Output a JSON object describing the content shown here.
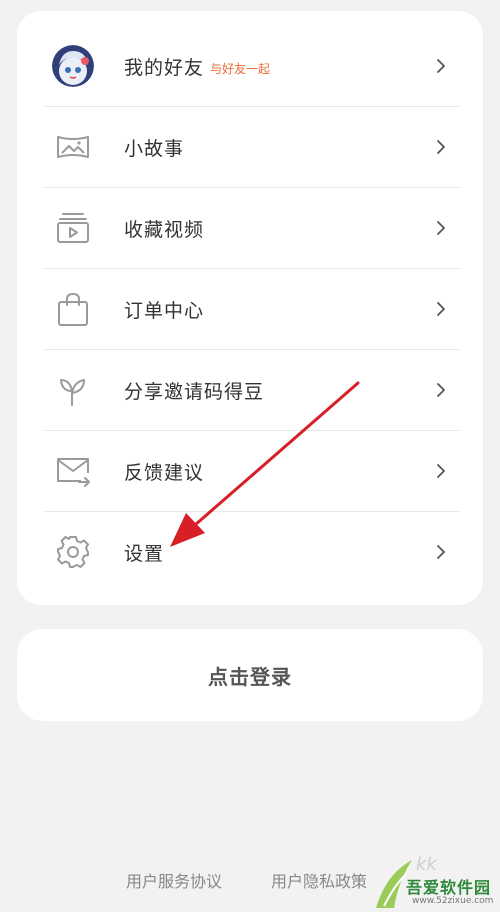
{
  "menu": {
    "items": [
      {
        "label": "我的好友",
        "sub": "与好友一起",
        "icon": "friend-avatar"
      },
      {
        "label": "小故事",
        "icon": "picture-icon"
      },
      {
        "label": "收藏视频",
        "icon": "video-collection-icon"
      },
      {
        "label": "订单中心",
        "icon": "shopping-bag-icon"
      },
      {
        "label": "分享邀请码得豆",
        "icon": "sprout-icon"
      },
      {
        "label": "反馈建议",
        "icon": "mail-feedback-icon"
      },
      {
        "label": "设置",
        "icon": "gear-icon"
      }
    ]
  },
  "login": {
    "label": "点击登录"
  },
  "footer": {
    "terms": "用户服务协议",
    "privacy": "用户隐私政策"
  },
  "watermark": {
    "name": "吾爱软件园",
    "url": "www.52zixue.com"
  },
  "colors": {
    "accent": "#ef6a33",
    "annotation_arrow": "#d81e26",
    "background": "#f2f2f2",
    "card": "#ffffff",
    "icon": "#9a9a9a"
  }
}
